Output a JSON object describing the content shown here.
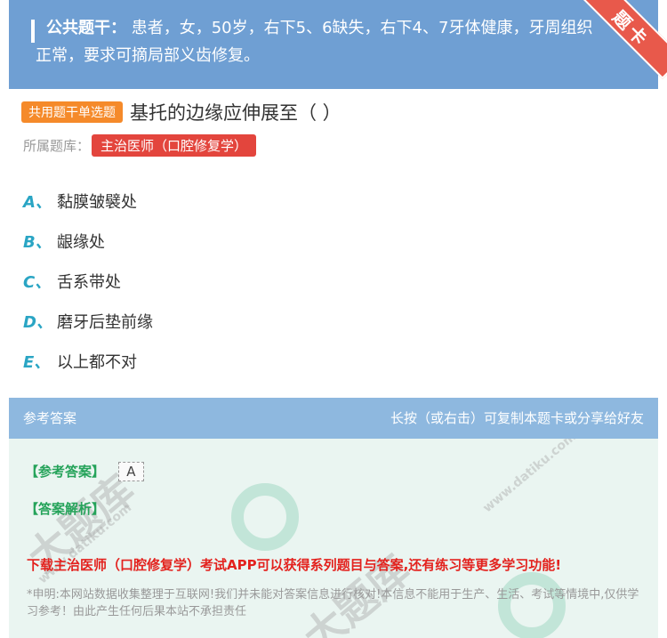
{
  "stem": {
    "label": "公共题干：",
    "text": "患者，女，50岁，右下5、6缺失，右下4、7牙体健康，牙周组织正常，要求可摘局部义齿修复。"
  },
  "corner_badge": "题卡",
  "question": {
    "type_tag": "共用题干单选题",
    "title": "基托的边缘应伸展至（ ）"
  },
  "bank": {
    "label": "所属题库：",
    "name": "主治医师（口腔修复学）"
  },
  "options": [
    {
      "letter": "A、",
      "text": "黏膜皱襞处"
    },
    {
      "letter": "B、",
      "text": "龈缘处"
    },
    {
      "letter": "C、",
      "text": "舌系带处"
    },
    {
      "letter": "D、",
      "text": "磨牙后垫前缘"
    },
    {
      "letter": "E、",
      "text": "以上都不对"
    }
  ],
  "answer_section": {
    "title": "参考答案",
    "hint": "长按（或右击）可复制本题卡或分享给好友",
    "answer_label": "【参考答案】",
    "answer_value": "A",
    "analysis_label": "【答案解析】",
    "promo": "下载主治医师（口腔修复学）考试APP可以获得系列题目与答案,还有练习等更多学习功能!",
    "disclaimer": "*申明:本网站数据收集整理于互联网!我们并未能对答案信息进行核对!本信息不能用于生产、生活、考试等情境中,仅供学习参考！由此产生任何后果本站不承担责任"
  },
  "watermark": {
    "brand": "大题库",
    "url": "www.datiku.com"
  },
  "colors": {
    "stem_bg": "#6f9fd3",
    "tag_orange": "#f58a2a",
    "badge_red": "#e3453d",
    "option_letter": "#2aa5c4",
    "answer_header_bg": "#8eb8df",
    "answer_green": "#25a35a",
    "promo_red": "#e3221e"
  }
}
